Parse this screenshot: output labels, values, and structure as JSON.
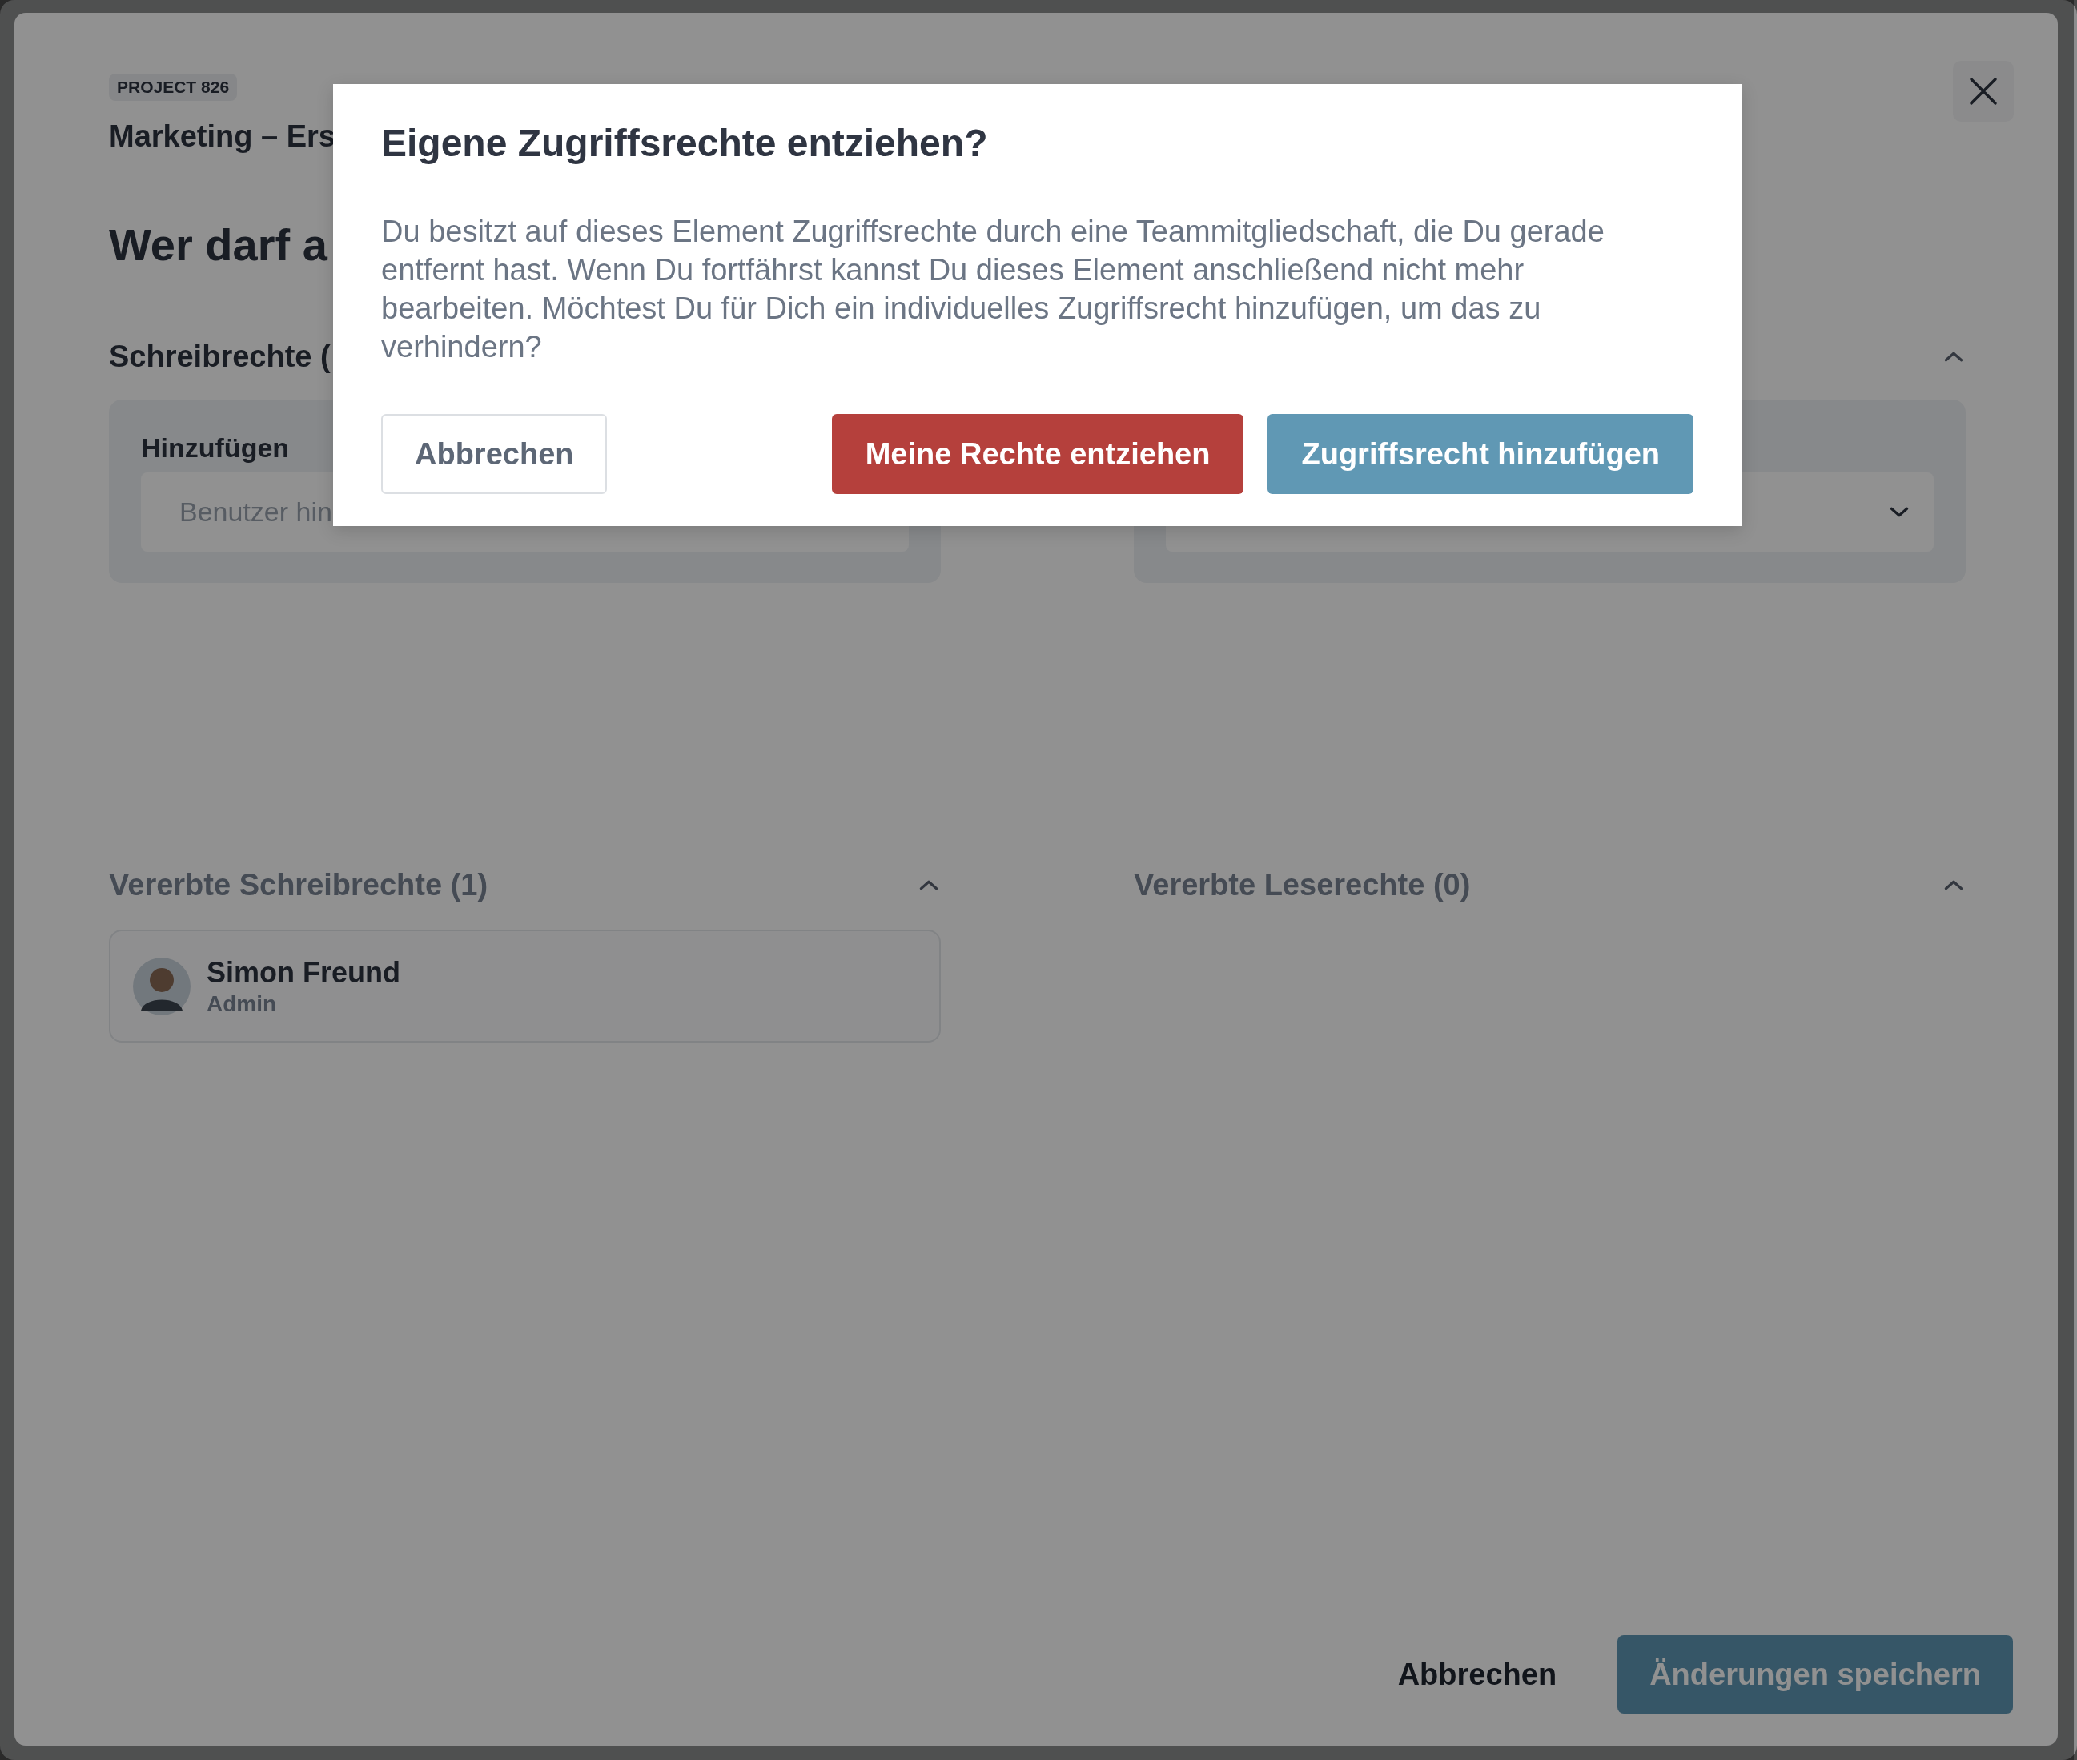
{
  "project_badge": "PROJECT 826",
  "project_title": "Marketing – Ers",
  "page_heading": "Wer darf a",
  "write_section": {
    "title": "Schreibrechte (",
    "add_label": "Hinzufügen",
    "placeholder": "Benutzer hin"
  },
  "read_section": {
    "expanded": true
  },
  "inherited_sections": [
    {
      "title": "Vererbte Schreibrechte (1)",
      "expanded": true,
      "members": [
        {
          "name": "Simon Freund",
          "role": "Admin"
        }
      ]
    },
    {
      "title": "Vererbte Leserechte (0)",
      "expanded": true
    }
  ],
  "footer": {
    "cancel": "Abbrechen",
    "save": "Änderungen speichern"
  },
  "dialog": {
    "title": "Eigene Zugriffsrechte entziehen?",
    "message": "Du besitzt auf dieses Element Zugriffsrechte durch eine Teammitgliedschaft, die Du gerade entfernt hast. Wenn Du fortfährst kannst Du dieses Element anschließend nicht mehr bearbeiten. Möchtest Du für Dich ein individuelles Zugriffsrecht hinzufügen, um das zu verhindern?",
    "buttons": [
      {
        "label": "Abbrechen",
        "kind": "secondary"
      },
      {
        "label": "Meine Rechte entziehen",
        "kind": "danger"
      },
      {
        "label": "Zugriffsrecht hinzufügen",
        "kind": "primary"
      }
    ]
  }
}
